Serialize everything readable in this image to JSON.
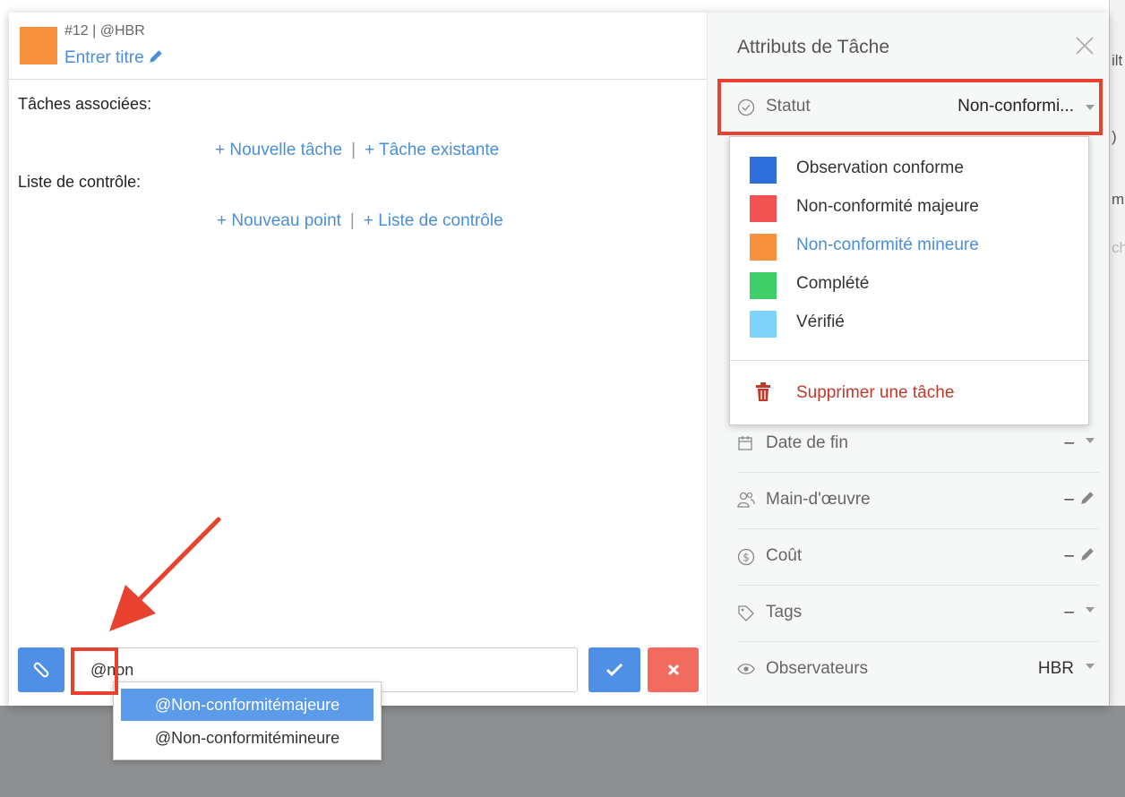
{
  "task": {
    "reference": "#12 | @HBR",
    "title_link": "Entrer titre",
    "color": "#f7913d"
  },
  "left": {
    "associated_tasks_label": "Tâches associées:",
    "new_task_link": "+ Nouvelle tâche",
    "existing_task_link": "+ Tâche existante",
    "checklist_label": "Liste de contrôle:",
    "new_point_link": "+ Nouveau point",
    "checklist_link": "+ Liste de contrôle",
    "separator": "|"
  },
  "comment": {
    "value": "@non",
    "attach_icon": "paperclip-icon",
    "confirm_icon": "check-icon",
    "cancel_icon": "times-icon"
  },
  "mention_suggestions": [
    {
      "label": "@Non-conformitémajeure",
      "active": true
    },
    {
      "label": "@Non-conformitémineure",
      "active": false
    }
  ],
  "panel": {
    "title": "Attributs de Tâche",
    "statut": {
      "label": "Statut",
      "value": "Non-conformi..."
    },
    "status_options": [
      {
        "label": "Observation conforme",
        "color": "#2f6fdc"
      },
      {
        "label": "Non-conformité majeure",
        "color": "#f25252"
      },
      {
        "label": "Non-conformité mineure",
        "color": "#f7913d",
        "selected": true
      },
      {
        "label": "Complété",
        "color": "#3fd06a"
      },
      {
        "label": "Vérifié",
        "color": "#7fd3fb"
      }
    ],
    "delete_label": "Supprimer une tâche",
    "attributes": [
      {
        "label": "Date de fin",
        "value": "–",
        "icon": "calendar-icon",
        "action": "dropdown"
      },
      {
        "label": "Main-d'œuvre",
        "value": "–",
        "icon": "people-icon",
        "action": "edit"
      },
      {
        "label": "Coût",
        "value": "–",
        "icon": "dollar-circle-icon",
        "action": "edit"
      },
      {
        "label": "Tags",
        "value": "–",
        "icon": "tag-icon",
        "action": "dropdown"
      },
      {
        "label": "Observateurs",
        "value": "HBR",
        "icon": "eye-icon",
        "action": "dropdown"
      }
    ]
  },
  "backdrop_edge": [
    "ilt",
    ")",
    "m",
    "ch"
  ],
  "colors": {
    "accent": "#4a8fd6",
    "button_blue": "#4f8fe6",
    "button_red": "#f36b5f",
    "highlight": "#e8412f",
    "delete": "#c0392b"
  }
}
